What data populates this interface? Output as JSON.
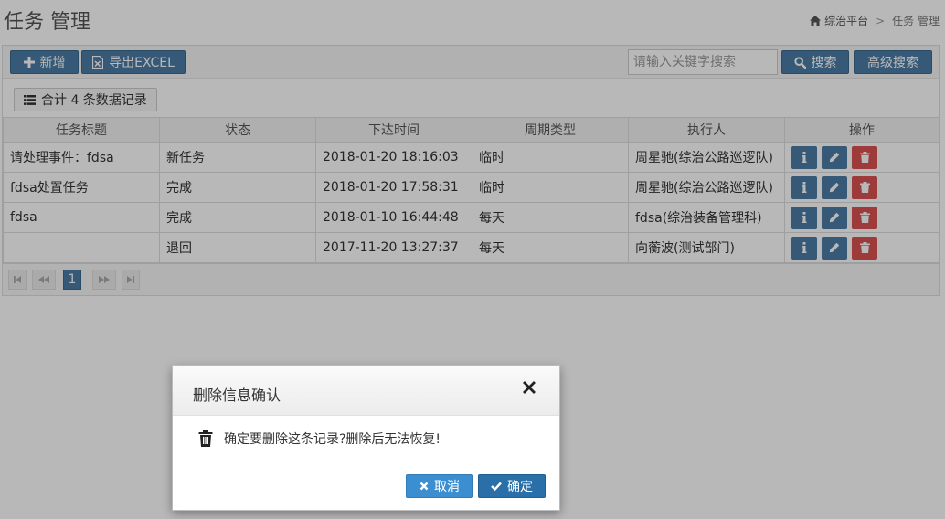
{
  "page_title": "任务 管理",
  "breadcrumb": {
    "home_label": "综治平台",
    "separator": ">",
    "current": "任务 管理"
  },
  "toolbar": {
    "add_label": "新增",
    "export_label": "导出EXCEL",
    "search_placeholder": "请输入关键字搜索",
    "search_value": "",
    "search_label": "搜索",
    "advanced_label": "高级搜索"
  },
  "summary": {
    "text": "合计 4 条数据记录"
  },
  "table": {
    "columns": [
      "任务标题",
      "状态",
      "下达时间",
      "周期类型",
      "执行人",
      "操作"
    ],
    "rows": [
      {
        "title": "请处理事件：fdsa",
        "status": "新任务",
        "time": "2018-01-20 18:16:03",
        "cycle": "临时",
        "executor": "周星驰(综治公路巡逻队)"
      },
      {
        "title": "fdsa处置任务",
        "status": "完成",
        "time": "2018-01-20 17:58:31",
        "cycle": "临时",
        "executor": "周星驰(综治公路巡逻队)"
      },
      {
        "title": "fdsa",
        "status": "完成",
        "time": "2018-01-10 16:44:48",
        "cycle": "每天",
        "executor": "fdsa(综治装备管理科)"
      },
      {
        "title": "",
        "status": "退回",
        "time": "2017-11-20 13:27:37",
        "cycle": "每天",
        "executor": "向蘅波(测试部门)"
      }
    ]
  },
  "pager": {
    "current_page": "1"
  },
  "icons": {
    "add": "plus-icon",
    "export": "excel-file-icon",
    "search": "search-icon",
    "list": "list-icon",
    "info": "info-icon",
    "edit": "pencil-icon",
    "delete": "trash-icon",
    "home": "home-icon"
  },
  "colors": {
    "primary": "#4a7ca5",
    "danger": "#d9534f",
    "cancel": "#3b8fd0",
    "ok": "#2a6fa8"
  },
  "modal": {
    "title": "删除信息确认",
    "message": "确定要删除这条记录?删除后无法恢复!",
    "cancel_label": "取消",
    "ok_label": "确定"
  }
}
